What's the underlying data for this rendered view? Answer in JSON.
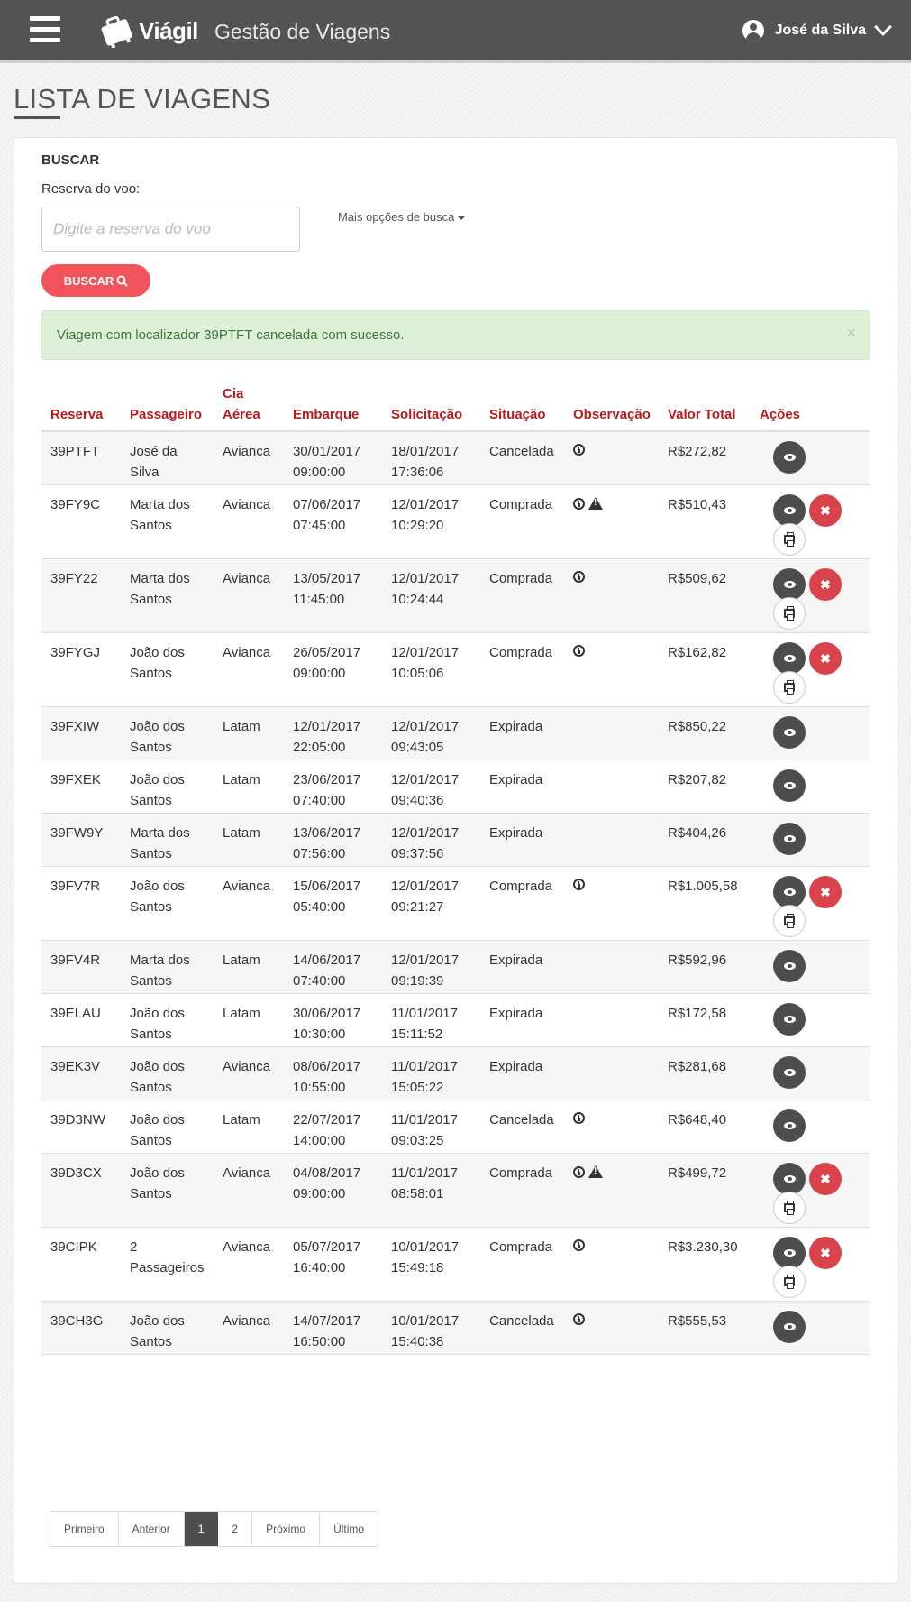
{
  "header": {
    "brand": "Viágil",
    "subtitle": "Gestão de Viagens",
    "user_name": "José da Silva"
  },
  "page": {
    "title": "LISTA DE VIAGENS"
  },
  "search": {
    "section_title": "BUSCAR",
    "field_label": "Reserva do voo:",
    "placeholder": "Digite a reserva do voo",
    "more_options": "Mais opções de busca",
    "button_label": "BUSCAR"
  },
  "alert": {
    "message": "Viagem com localizador 39PTFT cancelada com sucesso.",
    "close": "×"
  },
  "table": {
    "headers": {
      "reserva": "Reserva",
      "passageiro": "Passageiro",
      "cia_line1": "Cia",
      "cia_line2": "Aérea",
      "embarque": "Embarque",
      "solicitacao": "Solicitação",
      "situacao": "Situação",
      "observacao": "Observação",
      "valor": "Valor Total",
      "acoes": "Ações"
    },
    "rows": [
      {
        "reserva": "39PTFT",
        "pass1": "José da",
        "pass2": "Silva",
        "cia": "Avianca",
        "emb1": "30/01/2017",
        "emb2": "09:00:00",
        "sol1": "18/01/2017",
        "sol2": "17:36:06",
        "situacao": "Cancelada",
        "obs": [
          "clock"
        ],
        "valor": "R$272,82",
        "actions": [
          "view"
        ]
      },
      {
        "reserva": "39FY9C",
        "pass1": "Marta dos",
        "pass2": "Santos",
        "cia": "Avianca",
        "emb1": "07/06/2017",
        "emb2": "07:45:00",
        "sol1": "12/01/2017",
        "sol2": "10:29:20",
        "situacao": "Comprada",
        "obs": [
          "clock",
          "warning"
        ],
        "valor": "R$510,43",
        "actions": [
          "view",
          "cancel",
          "print"
        ]
      },
      {
        "reserva": "39FY22",
        "pass1": "Marta dos",
        "pass2": "Santos",
        "cia": "Avianca",
        "emb1": "13/05/2017",
        "emb2": "11:45:00",
        "sol1": "12/01/2017",
        "sol2": "10:24:44",
        "situacao": "Comprada",
        "obs": [
          "clock"
        ],
        "valor": "R$509,62",
        "actions": [
          "view",
          "cancel",
          "print"
        ]
      },
      {
        "reserva": "39FYGJ",
        "pass1": "João dos",
        "pass2": "Santos",
        "cia": "Avianca",
        "emb1": "26/05/2017",
        "emb2": "09:00:00",
        "sol1": "12/01/2017",
        "sol2": "10:05:06",
        "situacao": "Comprada",
        "obs": [
          "clock"
        ],
        "valor": "R$162,82",
        "actions": [
          "view",
          "cancel",
          "print"
        ]
      },
      {
        "reserva": "39FXIW",
        "pass1": "João dos",
        "pass2": "Santos",
        "cia": "Latam",
        "emb1": "12/01/2017",
        "emb2": "22:05:00",
        "sol1": "12/01/2017",
        "sol2": "09:43:05",
        "situacao": "Expirada",
        "obs": [],
        "valor": "R$850,22",
        "actions": [
          "view"
        ]
      },
      {
        "reserva": "39FXEK",
        "pass1": "João dos",
        "pass2": "Santos",
        "cia": "Latam",
        "emb1": "23/06/2017",
        "emb2": "07:40:00",
        "sol1": "12/01/2017",
        "sol2": "09:40:36",
        "situacao": "Expirada",
        "obs": [],
        "valor": "R$207,82",
        "actions": [
          "view"
        ]
      },
      {
        "reserva": "39FW9Y",
        "pass1": "Marta dos",
        "pass2": "Santos",
        "cia": "Latam",
        "emb1": "13/06/2017",
        "emb2": "07:56:00",
        "sol1": "12/01/2017",
        "sol2": "09:37:56",
        "situacao": "Expirada",
        "obs": [],
        "valor": "R$404,26",
        "actions": [
          "view"
        ]
      },
      {
        "reserva": "39FV7R",
        "pass1": "João dos",
        "pass2": "Santos",
        "cia": "Avianca",
        "emb1": "15/06/2017",
        "emb2": "05:40:00",
        "sol1": "12/01/2017",
        "sol2": "09:21:27",
        "situacao": "Comprada",
        "obs": [
          "clock"
        ],
        "valor": "R$1.005,58",
        "actions": [
          "view",
          "cancel",
          "print"
        ]
      },
      {
        "reserva": "39FV4R",
        "pass1": "Marta dos",
        "pass2": "Santos",
        "cia": "Latam",
        "emb1": "14/06/2017",
        "emb2": "07:40:00",
        "sol1": "12/01/2017",
        "sol2": "09:19:39",
        "situacao": "Expirada",
        "obs": [],
        "valor": "R$592,96",
        "actions": [
          "view"
        ]
      },
      {
        "reserva": "39ELAU",
        "pass1": "João dos",
        "pass2": "Santos",
        "cia": "Latam",
        "emb1": "30/06/2017",
        "emb2": "10:30:00",
        "sol1": "11/01/2017",
        "sol2": "15:11:52",
        "situacao": "Expirada",
        "obs": [],
        "valor": "R$172,58",
        "actions": [
          "view"
        ]
      },
      {
        "reserva": "39EK3V",
        "pass1": "João dos",
        "pass2": "Santos",
        "cia": "Avianca",
        "emb1": "08/06/2017",
        "emb2": "10:55:00",
        "sol1": "11/01/2017",
        "sol2": "15:05:22",
        "situacao": "Expirada",
        "obs": [],
        "valor": "R$281,68",
        "actions": [
          "view"
        ]
      },
      {
        "reserva": "39D3NW",
        "pass1": "João dos",
        "pass2": "Santos",
        "cia": "Latam",
        "emb1": "22/07/2017",
        "emb2": "14:00:00",
        "sol1": "11/01/2017",
        "sol2": "09:03:25",
        "situacao": "Cancelada",
        "obs": [
          "clock"
        ],
        "valor": "R$648,40",
        "actions": [
          "view"
        ]
      },
      {
        "reserva": "39D3CX",
        "pass1": "João dos",
        "pass2": "Santos",
        "cia": "Avianca",
        "emb1": "04/08/2017",
        "emb2": "09:00:00",
        "sol1": "11/01/2017",
        "sol2": "08:58:01",
        "situacao": "Comprada",
        "obs": [
          "clock",
          "warning"
        ],
        "valor": "R$499,72",
        "actions": [
          "view",
          "cancel",
          "print"
        ]
      },
      {
        "reserva": "39CIPK",
        "pass1": "2",
        "pass2": "Passageiros",
        "cia": "Avianca",
        "emb1": "05/07/2017",
        "emb2": "16:40:00",
        "sol1": "10/01/2017",
        "sol2": "15:49:18",
        "situacao": "Comprada",
        "obs": [
          "clock"
        ],
        "valor": "R$3.230,30",
        "actions": [
          "view",
          "cancel",
          "print"
        ]
      },
      {
        "reserva": "39CH3G",
        "pass1": "João dos",
        "pass2": "Santos",
        "cia": "Avianca",
        "emb1": "14/07/2017",
        "emb2": "16:50:00",
        "sol1": "10/01/2017",
        "sol2": "15:40:38",
        "situacao": "Cancelada",
        "obs": [
          "clock"
        ],
        "valor": "R$555,53",
        "actions": [
          "view"
        ]
      }
    ]
  },
  "pagination": {
    "items": [
      {
        "label": "Primeiro",
        "active": false
      },
      {
        "label": "Anterior",
        "active": false
      },
      {
        "label": "1",
        "active": true
      },
      {
        "label": "2",
        "active": false
      },
      {
        "label": "Próximo",
        "active": false
      },
      {
        "label": "Último",
        "active": false
      }
    ]
  },
  "colors": {
    "header_bg": "#535353",
    "accent_red": "#f0535b",
    "column_header": "#b71c1c",
    "success_bg": "#dff0d8"
  }
}
